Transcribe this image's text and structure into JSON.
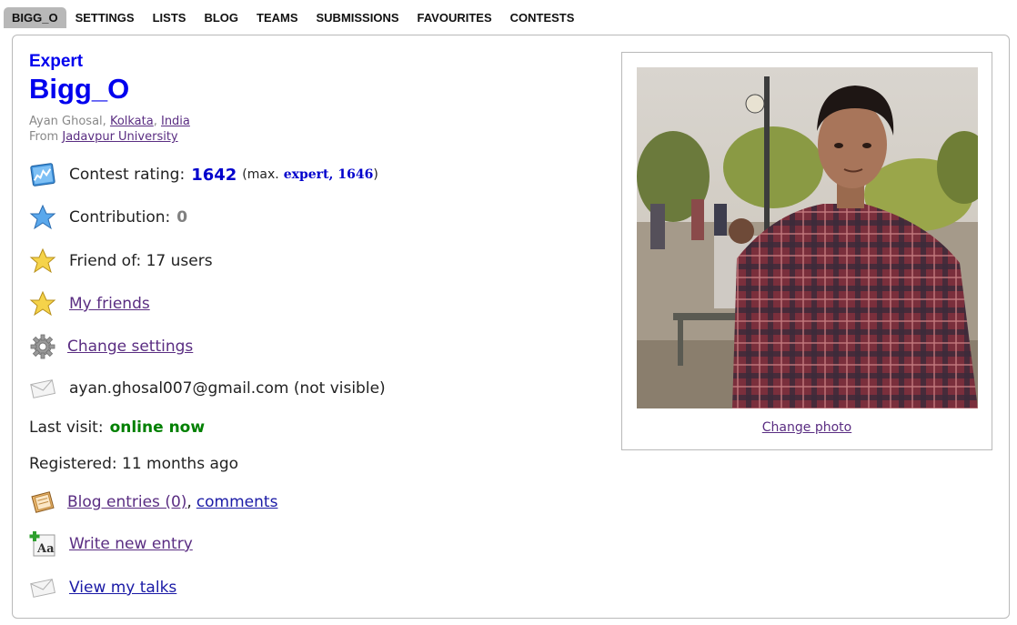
{
  "tabs": [
    "BIGG_O",
    "SETTINGS",
    "LISTS",
    "BLOG",
    "TEAMS",
    "SUBMISSIONS",
    "FAVOURITES",
    "CONTESTS"
  ],
  "profile": {
    "rank": "Expert",
    "handle": "Bigg_O",
    "name": "Ayan Ghosal",
    "sep": ", ",
    "city": "Kolkata",
    "country": "India",
    "from_label": "From",
    "university": "Jadavpur University",
    "rating_label": "Contest rating:",
    "rating": "1642",
    "max_open": "(max.",
    "max_rank": "expert,",
    "max_rating": "1646",
    "max_close": ")",
    "contribution_label": "Contribution:",
    "contribution": "0",
    "friend_of": "Friend of: 17 users",
    "my_friends": "My friends",
    "change_settings": "Change settings",
    "email": "ayan.ghosal007@gmail.com (not visible)",
    "last_visit_label": "Last visit:",
    "last_visit": "online now",
    "registered": "Registered: 11 months ago",
    "blog_entries": "Blog entries (0)",
    "comma": ",",
    "comments": "comments",
    "write_entry": "Write new entry",
    "view_talks": "View my talks",
    "change_photo": "Change photo"
  },
  "colors": {
    "accent_blue": "#0000ee",
    "online_green": "#008000",
    "link_purple": "#5a2d82"
  },
  "icons": [
    "rating-chart-icon",
    "blue-star-icon",
    "gold-star-icon",
    "gold-star-icon",
    "gear-icon",
    "envelope-icon",
    "blog-book-icon",
    "write-entry-icon",
    "envelope-icon"
  ]
}
